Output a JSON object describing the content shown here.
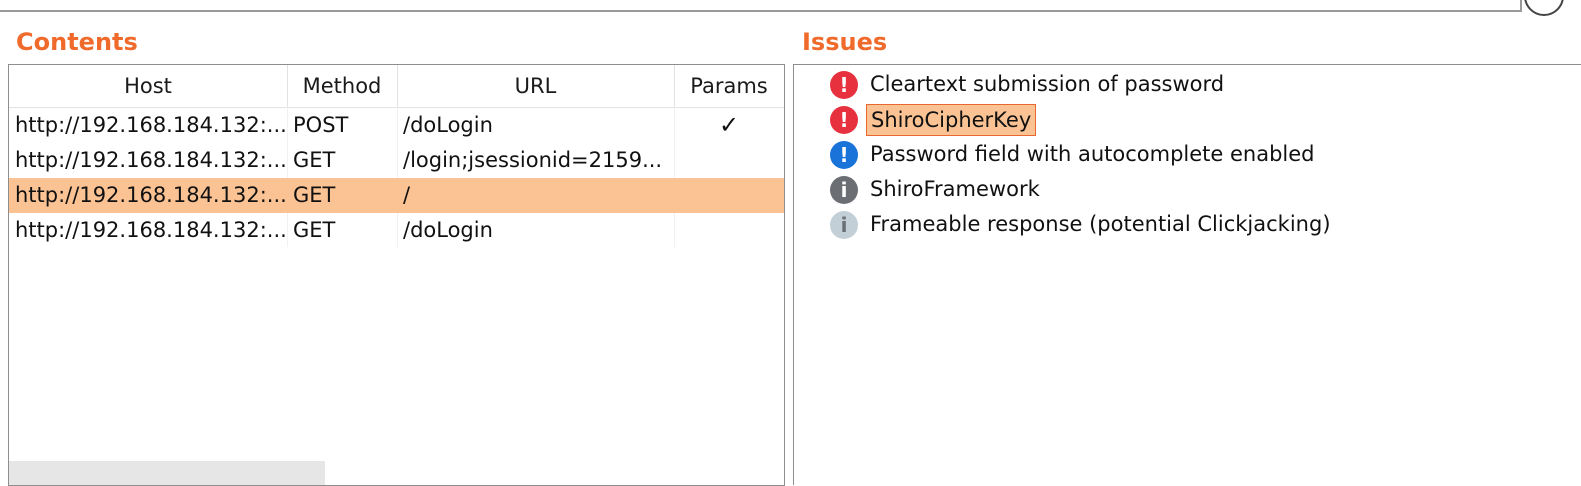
{
  "contents": {
    "title": "Contents",
    "columns": [
      "Host",
      "Method",
      "URL",
      "Params"
    ],
    "rows": [
      {
        "host": "http://192.168.184.132:...",
        "method": "POST",
        "url": "/doLogin",
        "params": "✓",
        "selected": false
      },
      {
        "host": "http://192.168.184.132:...",
        "method": "GET",
        "url": "/login;jsessionid=2159...",
        "params": "",
        "selected": false
      },
      {
        "host": "http://192.168.184.132:...",
        "method": "GET",
        "url": "/",
        "params": "",
        "selected": true
      },
      {
        "host": "http://192.168.184.132:...",
        "method": "GET",
        "url": "/doLogin",
        "params": "",
        "selected": false
      }
    ]
  },
  "issues": {
    "title": "Issues",
    "items": [
      {
        "label": "Cleartext submission of password",
        "icon": "high-severity-icon",
        "glyph": "!",
        "selected": false
      },
      {
        "label": "ShiroCipherKey",
        "icon": "high-severity-icon",
        "glyph": "!",
        "selected": true
      },
      {
        "label": "Password field with autocomplete enabled",
        "icon": "low-severity-icon",
        "glyph": "!",
        "selected": false
      },
      {
        "label": "ShiroFramework",
        "icon": "info-severity-icon",
        "glyph": "i",
        "selected": false
      },
      {
        "label": "Frameable response (potential Clickjacking)",
        "icon": "info-tentative-icon",
        "glyph": "i",
        "selected": false
      }
    ]
  },
  "colors": {
    "accent": "#f06a2b",
    "selection": "#fbc394",
    "high": "#e8313f",
    "low": "#1a73d9",
    "info": "#6b6f74",
    "info_light": "#c3cfd6"
  }
}
